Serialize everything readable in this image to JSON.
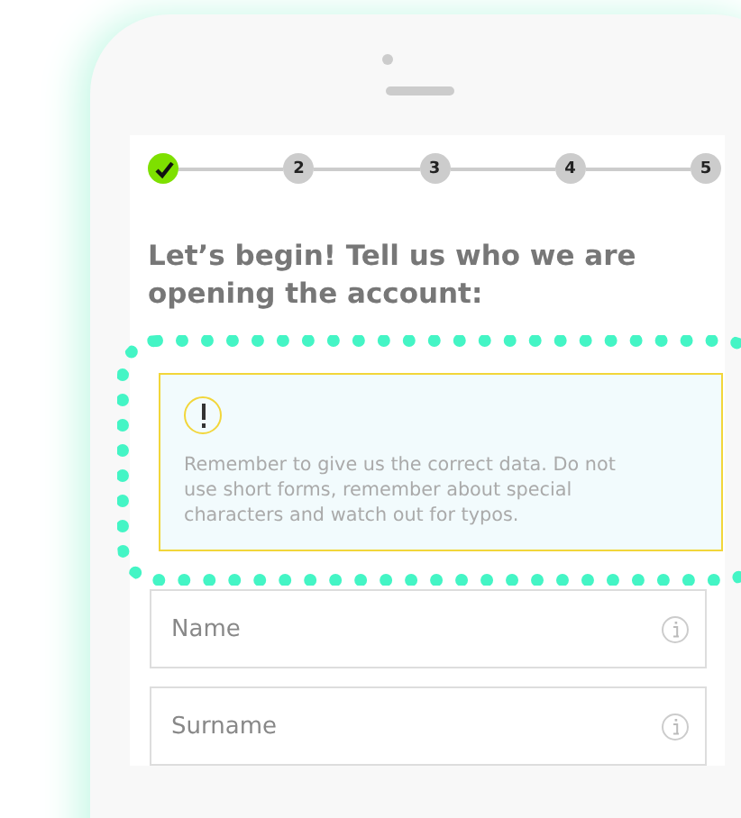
{
  "steps": [
    {
      "completed": true
    },
    {
      "label": "2",
      "completed": false
    },
    {
      "label": "3",
      "completed": false
    },
    {
      "label": "4",
      "completed": false
    },
    {
      "label": "5",
      "completed": false
    }
  ],
  "heading": "Let’s begin! Tell us who we are opening the account:",
  "notice": {
    "highlighted": true,
    "text": "Remember to give us the correct data. Do not use short forms, remember about special characters and watch out for typos."
  },
  "fields": [
    {
      "placeholder": "Name"
    },
    {
      "placeholder": "Surname"
    }
  ]
}
